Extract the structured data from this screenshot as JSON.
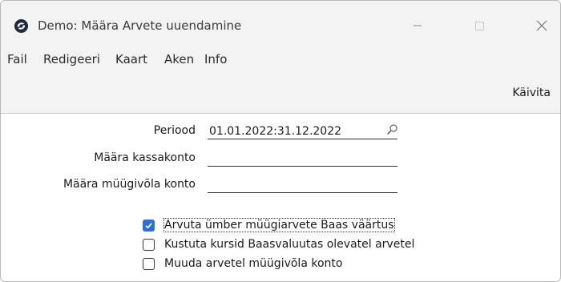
{
  "window": {
    "title": "Demo: Määra Arvete uuendamine"
  },
  "menu": [
    {
      "label": "Fail"
    },
    {
      "label": "Redigeeri"
    },
    {
      "label": "Kaart"
    },
    {
      "label": "Aken"
    },
    {
      "label": "Info"
    }
  ],
  "toolbar": {
    "run_label": "Käivita"
  },
  "form": {
    "period": {
      "label": "Periood",
      "value": "01.01.2022:31.12.2022"
    },
    "cash_account": {
      "label": "Määra kassakonto",
      "value": ""
    },
    "sales_account": {
      "label": "Määra müügivõla konto",
      "value": ""
    }
  },
  "options": [
    {
      "label": "Arvuta ümber müügiarvete Baas väärtus",
      "checked": true
    },
    {
      "label": "Kustuta kursid Baasvaluutas olevatel arvetel",
      "checked": false
    },
    {
      "label": "Muuda arvetel müügivõla konto",
      "checked": false
    }
  ],
  "colors": {
    "accent": "#2f6fcf",
    "chrome": "#f3f3f3"
  },
  "icons": {
    "app": "app-logo-icon",
    "minimize": "minimize-icon",
    "maximize": "maximize-icon",
    "close": "close-icon",
    "search": "search-icon",
    "check": "checkmark-icon"
  }
}
